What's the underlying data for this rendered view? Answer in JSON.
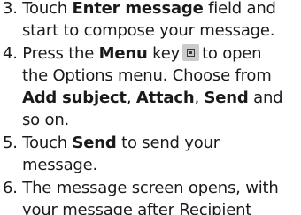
{
  "steps": [
    {
      "number": "3.",
      "line1": {
        "pre": " Touch ",
        "bold": "Enter message",
        "post": " field and"
      },
      "line2": "start to compose your message."
    },
    {
      "number": "4.",
      "line1": {
        "pre": " Press the ",
        "bold": "Menu",
        "mid": " key",
        "post": "to open"
      },
      "line2": "the Options menu. Choose from",
      "line3": {
        "bold1": "Add subject",
        "sep1": ", ",
        "bold2": "Attach",
        "sep2": ", ",
        "bold3": "Send",
        "post": " and"
      },
      "line4": "so on.",
      "icon": "menu-key-icon"
    },
    {
      "number": "5.",
      "line1": {
        "pre": " Touch ",
        "bold": "Send",
        "post": " to send your"
      },
      "line2": "message."
    },
    {
      "number": "6.",
      "line1": {
        "pre": " The message screen opens, with"
      },
      "line2": "your message after Recipient"
    }
  ]
}
